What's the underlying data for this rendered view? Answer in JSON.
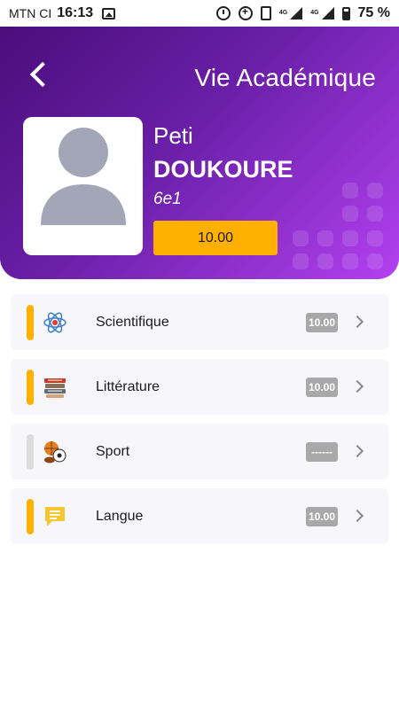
{
  "status_bar": {
    "carrier": "MTN CI",
    "time": "16:13",
    "network_a": "4G",
    "network_b": "4G",
    "battery": "75 %"
  },
  "header": {
    "title": "Vie Académique",
    "first_name": "Peti",
    "last_name": "DOUKOURE",
    "class_name": "6e1",
    "average": "10.00"
  },
  "subjects": [
    {
      "label": "Scientifique",
      "score": "10.00",
      "accent": "#ffb000",
      "icon": "atom-icon"
    },
    {
      "label": "Littérature",
      "score": "10.00",
      "accent": "#ffb000",
      "icon": "books-icon"
    },
    {
      "label": "Sport",
      "score": "------",
      "accent": "#dcdcdc",
      "icon": "sports-balls-icon"
    },
    {
      "label": "Langue",
      "score": "10.00",
      "accent": "#ffb000",
      "icon": "speech-bubble-icon"
    }
  ],
  "colors": {
    "header_start": "#4a0e7a",
    "header_end": "#b341f0",
    "accent": "#ffb000",
    "score_badge": "#a8a8a8"
  }
}
